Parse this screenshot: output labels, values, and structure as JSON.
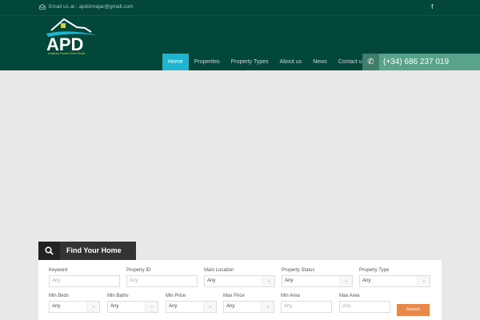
{
  "topbar": {
    "email": "Email us at : apdizmajar@gmail.com",
    "social": "f"
  },
  "logo": {
    "text": "APD",
    "tagline": "Andalucia Property Direct Ulrajar"
  },
  "nav": [
    {
      "label": "Home"
    },
    {
      "label": "Properties"
    },
    {
      "label": "Property Types"
    },
    {
      "label": "About us"
    },
    {
      "label": "News"
    },
    {
      "label": "Contact us"
    }
  ],
  "phone": "(+34) 686 237 019",
  "search": {
    "title": "Find Your Home",
    "button": "Search",
    "row1": [
      {
        "label": "Keyword",
        "value": "Any",
        "type": "text"
      },
      {
        "label": "Property ID",
        "value": "Any",
        "type": "text"
      },
      {
        "label": "Main Location",
        "value": "Any",
        "type": "select"
      },
      {
        "label": "Property Status",
        "value": "Any",
        "type": "select"
      },
      {
        "label": "Property Type",
        "value": "Any",
        "type": "select"
      }
    ],
    "row2": [
      {
        "label": "Min Beds",
        "value": "Any",
        "type": "select"
      },
      {
        "label": "Min Baths",
        "value": "Any",
        "type": "select"
      },
      {
        "label": "Min Price",
        "value": "Any",
        "type": "select"
      },
      {
        "label": "Max Price",
        "value": "Any",
        "type": "select"
      },
      {
        "label": "Min Area",
        "value": "Any",
        "type": "text"
      },
      {
        "label": "Max Area",
        "value": "Any",
        "type": "text"
      }
    ]
  },
  "colors": {
    "header": "#03473a",
    "active": "#1fb5d0",
    "phone": "#5aa38b",
    "button": "#e8884a"
  }
}
